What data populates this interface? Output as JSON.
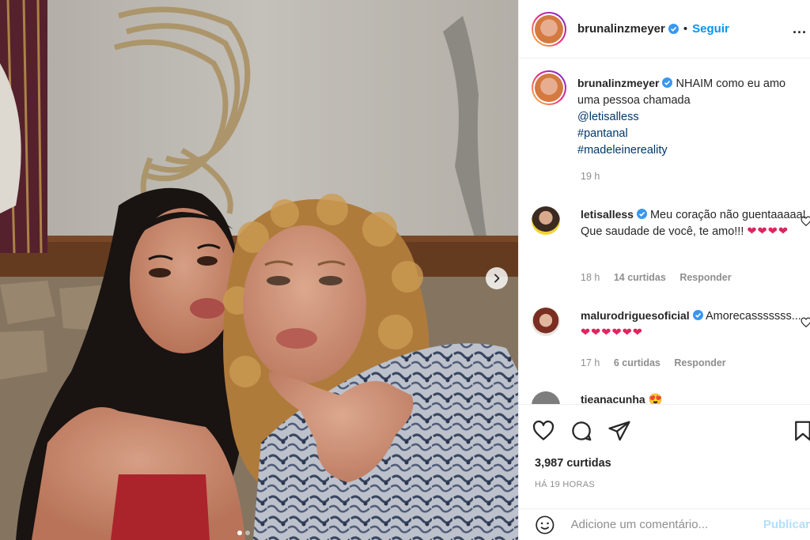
{
  "post": {
    "author": "brunalinzmeyer",
    "follow_label": "Seguir",
    "dot": "•",
    "more_label": "...",
    "caption": {
      "text": "NHAIM como eu amo uma pessoa chamada",
      "mention": "@letisalless",
      "hashtags": [
        "#pantanal",
        "#madeleinereality"
      ],
      "time": "19 h"
    }
  },
  "comments": [
    {
      "user": "letisalless",
      "text": "Meu coração não guentaaaaa! Que saudade de você, te amo!!!",
      "emojis": "❤❤❤❤",
      "time": "18 h",
      "likes": "14 curtidas",
      "reply": "Responder"
    },
    {
      "user": "malurodriguesoficial",
      "text": "Amorecasssssss...",
      "emojis": "❤❤❤❤❤❤",
      "time": "17 h",
      "likes": "6 curtidas",
      "reply": "Responder"
    },
    {
      "user": "tieanacunha",
      "emojis": "😍"
    }
  ],
  "actions": {
    "likes_count": "3,987 curtidas",
    "time_ago": "HÁ 19 HORAS"
  },
  "add_comment": {
    "placeholder": "Adicione um comentário...",
    "publish_label": "Publicar"
  },
  "colors": {
    "accent": "#0095f6",
    "link": "#00376b",
    "muted": "#8e8e8e",
    "heart": "#ed4956"
  }
}
